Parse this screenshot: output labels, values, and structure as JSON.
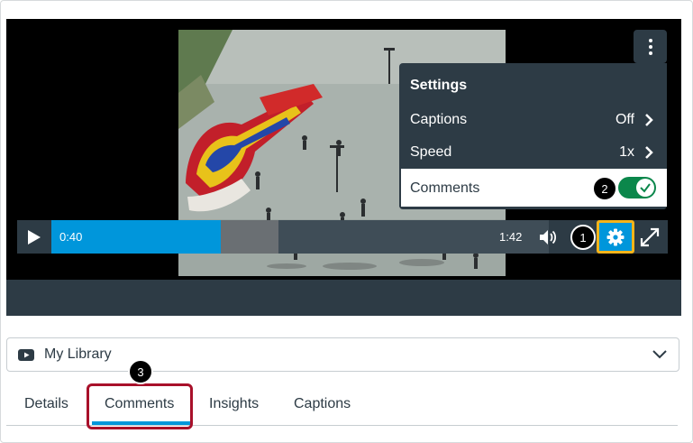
{
  "player": {
    "current_time": "0:40",
    "duration": "1:42",
    "progress_fraction": 0.34
  },
  "settings_menu": {
    "title": "Settings",
    "captions_label": "Captions",
    "captions_value": "Off",
    "speed_label": "Speed",
    "speed_value": "1x",
    "comments_label": "Comments",
    "comments_enabled": true
  },
  "callouts": {
    "one": "1",
    "two": "2",
    "three": "3"
  },
  "library": {
    "label": "My Library"
  },
  "tabs": {
    "details": "Details",
    "comments": "Comments",
    "insights": "Insights",
    "captions": "Captions",
    "active": "Comments"
  },
  "colors": {
    "accent": "#0096db",
    "control_bar": "#2d3b45",
    "toggle_on": "#0b874b",
    "gear_highlight": "#f5b41a",
    "tab_highlight": "#a8102a"
  },
  "icons": {
    "play": "play-icon",
    "volume": "volume-icon",
    "settings": "gear-icon",
    "fullscreen": "fullscreen-icon",
    "more": "kebab-icon",
    "library": "youtube-icon",
    "dropdown": "chevron-down-icon"
  }
}
